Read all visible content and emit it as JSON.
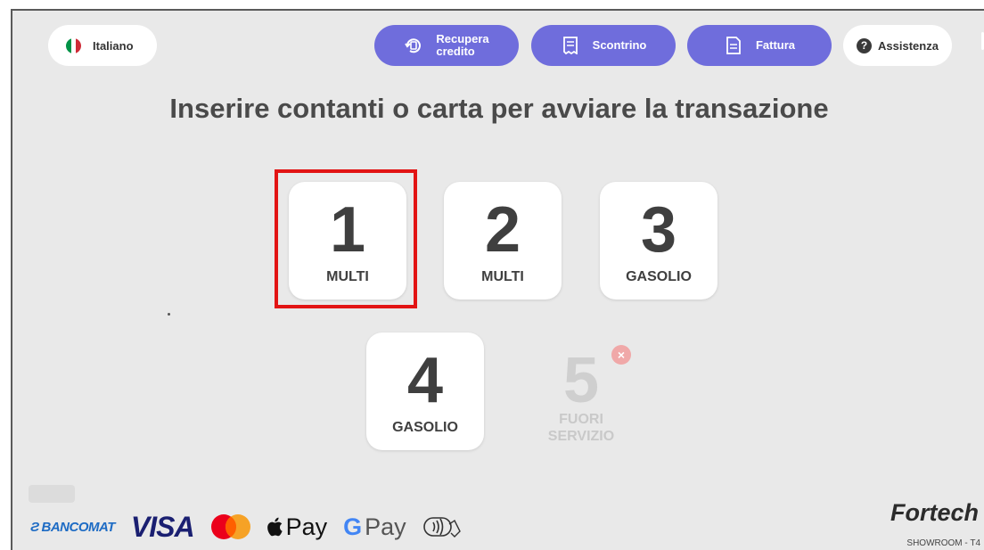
{
  "header": {
    "language_label": "Italiano",
    "recupera_line1": "Recupera",
    "recupera_line2": "credito",
    "scontrino_label": "Scontrino",
    "fattura_label": "Fattura",
    "assistenza_label": "Assistenza",
    "help_glyph": "?",
    "icons": [
      "italy-flag-icon",
      "refund-icon",
      "receipt-icon",
      "invoice-icon",
      "help-icon"
    ]
  },
  "headline": "Inserire contanti o carta per avviare la transazione",
  "pumps": [
    {
      "number": "1",
      "fuel": "MULTI",
      "status": "available",
      "selected": true
    },
    {
      "number": "2",
      "fuel": "MULTI",
      "status": "available"
    },
    {
      "number": "3",
      "fuel": "GASOLIO",
      "status": "available"
    },
    {
      "number": "4",
      "fuel": "GASOLIO",
      "status": "available"
    },
    {
      "number": "5",
      "fuel_line1": "FUORI",
      "fuel_line2": "SERVIZIO",
      "status": "out-of-service",
      "badge_glyph": "×"
    }
  ],
  "payments": {
    "bancomat": "BANCOMAT",
    "bancomat_mark": "Ƨ",
    "visa": "VISA",
    "apple_pay": "Pay",
    "google_pay": "Pay",
    "google_g": "G"
  },
  "brand": "Fortech",
  "station": "SHOWROOM - T4",
  "colors": {
    "accent_purple": "#6f6ddc",
    "highlight_red": "#e21414",
    "background": "#e9e9e9",
    "mastercard_red": "#eb001b",
    "mastercard_yellow": "#f79e1b",
    "flag_green": "#009246",
    "flag_red": "#ce2b37"
  }
}
